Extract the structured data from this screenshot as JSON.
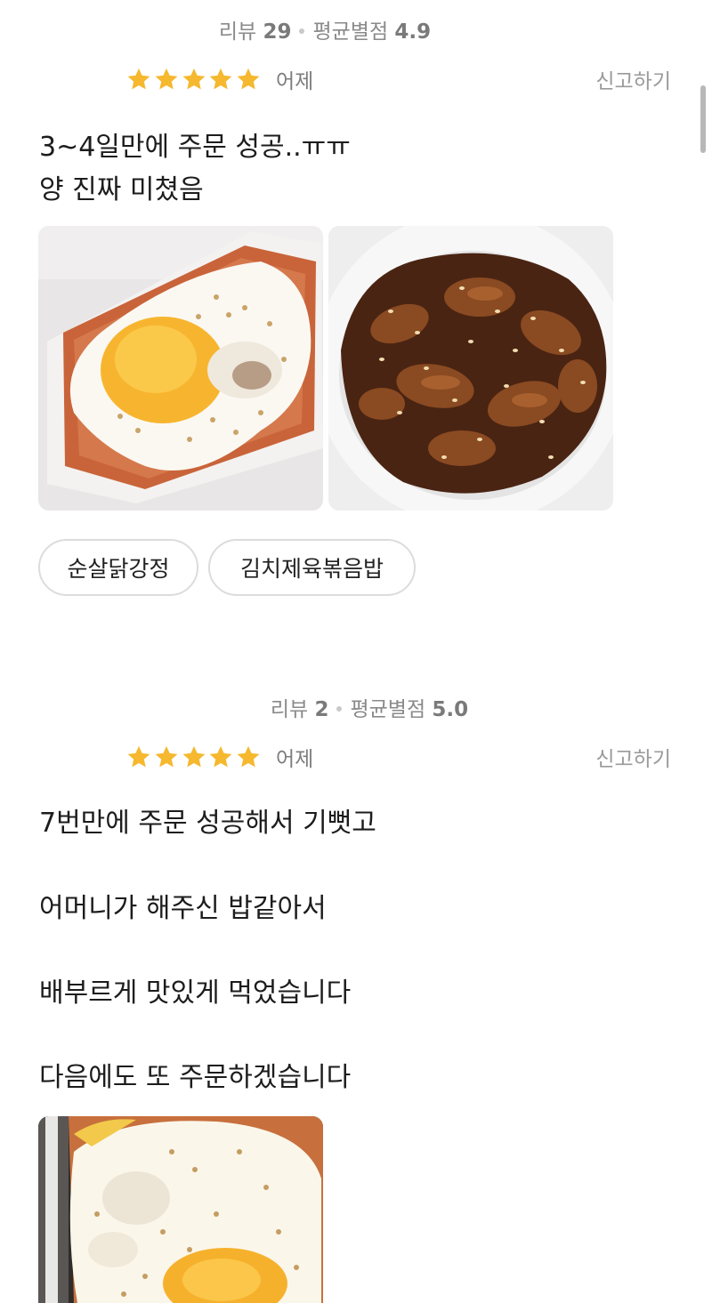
{
  "reviews": [
    {
      "stats": {
        "review_label": "리뷰",
        "review_count": "29",
        "avg_label": "평균별점",
        "avg_value": "4.9"
      },
      "rating": 5,
      "date": "어제",
      "report_label": "신고하기",
      "lines": [
        "3~4일만에 주문 성공..ㅠㅠ",
        "양 진짜 미쳤음"
      ],
      "menu_tags": [
        "순살닭강정",
        "김치제육볶음밥"
      ]
    },
    {
      "stats": {
        "review_label": "리뷰",
        "review_count": "2",
        "avg_label": "평균별점",
        "avg_value": "5.0"
      },
      "rating": 5,
      "date": "어제",
      "report_label": "신고하기",
      "lines": [
        "7번만에 주문 성공해서 기뻣고",
        "어머니가 해주신 밥같아서",
        "배부르게 맛있게 먹었습니다",
        "다음에도 또 주문하겠습니다"
      ],
      "menu_tags": []
    }
  ],
  "colors": {
    "star": "#f5b82e",
    "muted_text": "#8a8a8a",
    "chip_border": "#dcdcdc"
  },
  "icons": {
    "rating": "star-icon",
    "stats_separator": "dot-separator"
  }
}
